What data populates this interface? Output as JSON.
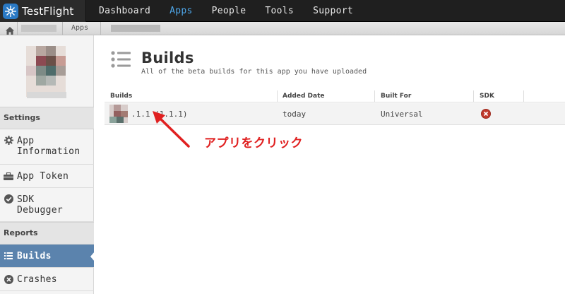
{
  "brand": {
    "name": "TestFlight"
  },
  "nav": {
    "items": [
      "Dashboard",
      "Apps",
      "People",
      "Tools",
      "Support"
    ],
    "active": "Apps"
  },
  "breadcrumb": {
    "apps_label": "Apps"
  },
  "sidebar": {
    "sections": [
      {
        "title": "Settings"
      },
      {
        "title": "Reports"
      }
    ],
    "items": [
      {
        "label_line1": "App",
        "label_line2": "Information",
        "icon": "gear-icon"
      },
      {
        "label_line1": "App Token",
        "icon": "toolbox-icon"
      },
      {
        "label_line1": "SDK",
        "label_line2": "Debugger",
        "icon": "check-circle-icon"
      },
      {
        "label_line1": "Builds",
        "icon": "list-icon",
        "active": true
      },
      {
        "label_line1": "Crashes",
        "icon": "x-circle-icon"
      }
    ]
  },
  "page": {
    "title": "Builds",
    "subtitle": "All of the beta builds for this app you have uploaded"
  },
  "table": {
    "headers": [
      "Builds",
      "Added Date",
      "Built For",
      "SDK"
    ],
    "rows": [
      {
        "build": ".1.1 (1.1.1)",
        "added": "today",
        "built_for": "Universal",
        "sdk_status": "error"
      }
    ]
  },
  "annotation": {
    "text": "アプリをクリック",
    "color": "#e02020"
  },
  "colors": {
    "accent": "#4ea6e8",
    "active_sidebar": "#5b83ad",
    "error": "#c0392b"
  }
}
